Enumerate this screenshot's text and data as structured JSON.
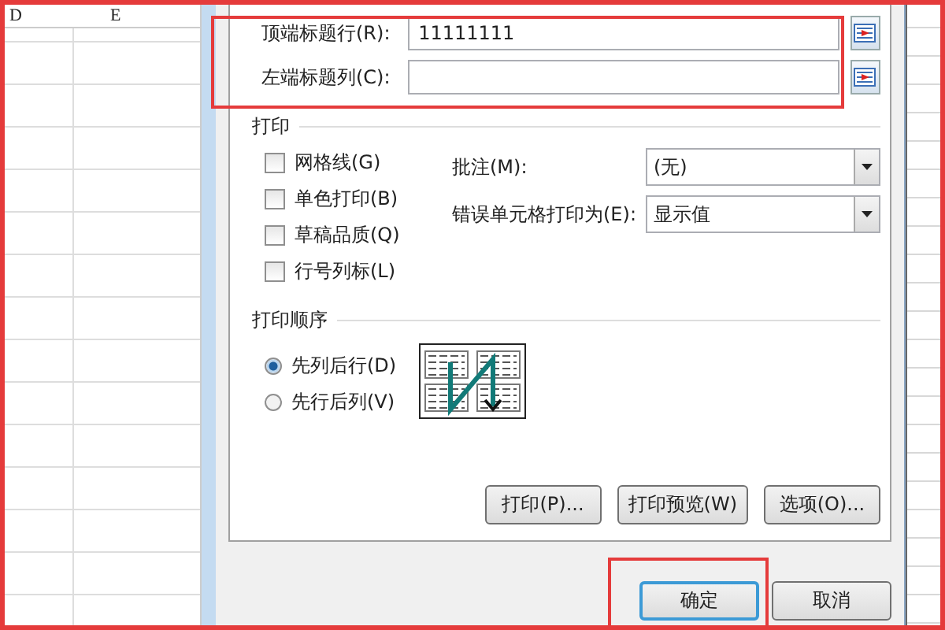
{
  "sheet": {
    "column_headers": [
      "D",
      "E"
    ]
  },
  "title_rows": [
    {
      "label": "顶端标题行(R):",
      "value": "11111111"
    },
    {
      "label": "左端标题列(C):"
    }
  ],
  "print": {
    "title": "打印",
    "options": [
      {
        "label": "网格线(G)",
        "checked": false
      },
      {
        "label": "单色打印(B)",
        "checked": false
      },
      {
        "label": "草稿品质(Q)",
        "checked": false
      },
      {
        "label": "行号列标(L)",
        "checked": false
      }
    ],
    "selects": [
      {
        "label": "批注(M):",
        "value": "(无)"
      },
      {
        "label": "错误单元格打印为(E):",
        "value": "显示值"
      }
    ]
  },
  "order": {
    "title": "打印顺序",
    "options": [
      {
        "label": "先列后行(D)",
        "selected": true
      },
      {
        "label": "先行后列(V)",
        "selected": false
      }
    ]
  },
  "tab_buttons": [
    "打印(P)...",
    "打印预览(W)",
    "选项(O)..."
  ],
  "buttons": [
    {
      "label": "确定",
      "default": true
    },
    {
      "label": "取消",
      "default": false
    }
  ]
}
